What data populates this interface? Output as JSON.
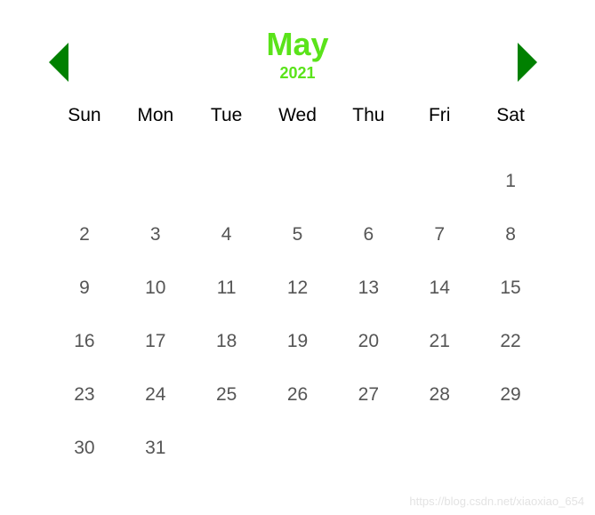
{
  "calendar": {
    "month": "May",
    "year": "2021",
    "weekdays": [
      "Sun",
      "Mon",
      "Tue",
      "Wed",
      "Thu",
      "Fri",
      "Sat"
    ],
    "leading_blanks": 6,
    "days": [
      1,
      2,
      3,
      4,
      5,
      6,
      7,
      8,
      9,
      10,
      11,
      12,
      13,
      14,
      15,
      16,
      17,
      18,
      19,
      20,
      21,
      22,
      23,
      24,
      25,
      26,
      27,
      28,
      29,
      30,
      31
    ]
  },
  "watermark": "https://blog.csdn.net/xiaoxiao_654"
}
